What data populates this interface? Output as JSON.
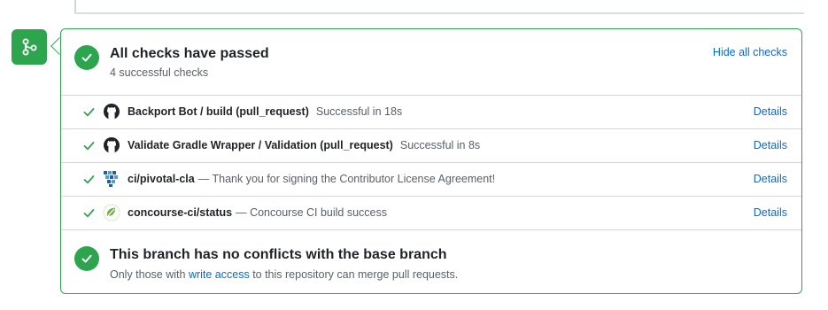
{
  "checks_header": {
    "title": "All checks have passed",
    "subtitle": "4 successful checks",
    "hide_label": "Hide all checks"
  },
  "checks": [
    {
      "name": "Backport Bot / build (pull_request)",
      "status": "Successful in 18s",
      "details_label": "Details",
      "icon": "github-icon"
    },
    {
      "name": "Validate Gradle Wrapper / Validation (pull_request)",
      "status": "Successful in 8s",
      "details_label": "Details",
      "icon": "github-icon"
    },
    {
      "name": "ci/pivotal-cla",
      "status": "— Thank you for signing the Contributor License Agreement!",
      "details_label": "Details",
      "icon": "pivotal-icon"
    },
    {
      "name": "concourse-ci/status",
      "status": "— Concourse CI build success",
      "details_label": "Details",
      "icon": "spring-icon"
    }
  ],
  "merge_status": {
    "title": "This branch has no conflicts with the base branch",
    "sub_prefix": "Only those with ",
    "sub_link": "write access",
    "sub_suffix": " to this repository can merge pull requests."
  },
  "colors": {
    "success": "#2da44e",
    "link": "#0969da",
    "muted": "#57606a"
  }
}
